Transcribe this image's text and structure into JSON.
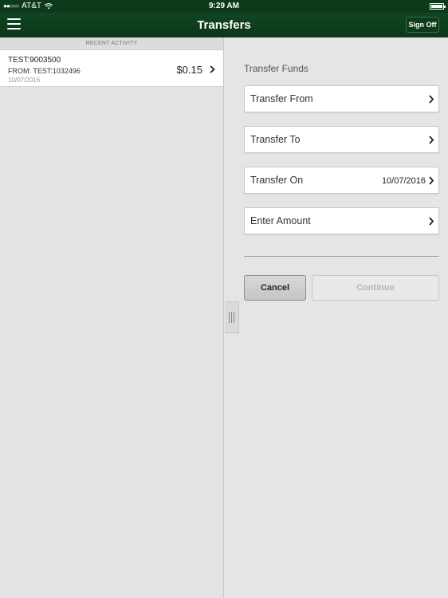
{
  "status_bar": {
    "signal": "●●○○○",
    "carrier": "AT&T",
    "time": "9:29 AM"
  },
  "nav": {
    "title": "Transfers",
    "sign_off_label": "Sign Off"
  },
  "recent_activity": {
    "header": "RECENT ACTIVITY",
    "items": [
      {
        "name": "TEST:9003500",
        "from": "FROM: TEST:1032496",
        "date": "10/07/2016",
        "amount": "$0.15"
      }
    ]
  },
  "transfer_form": {
    "title": "Transfer Funds",
    "from_label": "Transfer From",
    "to_label": "Transfer To",
    "on_label": "Transfer On",
    "on_value": "10/07/2016",
    "amount_label": "Enter Amount",
    "cancel_label": "Cancel",
    "continue_label": "Continue"
  },
  "colors": {
    "nav_green": "#0e3a1c",
    "pane_bg": "#e5e5e5",
    "disabled_text": "#b5b5b5"
  }
}
